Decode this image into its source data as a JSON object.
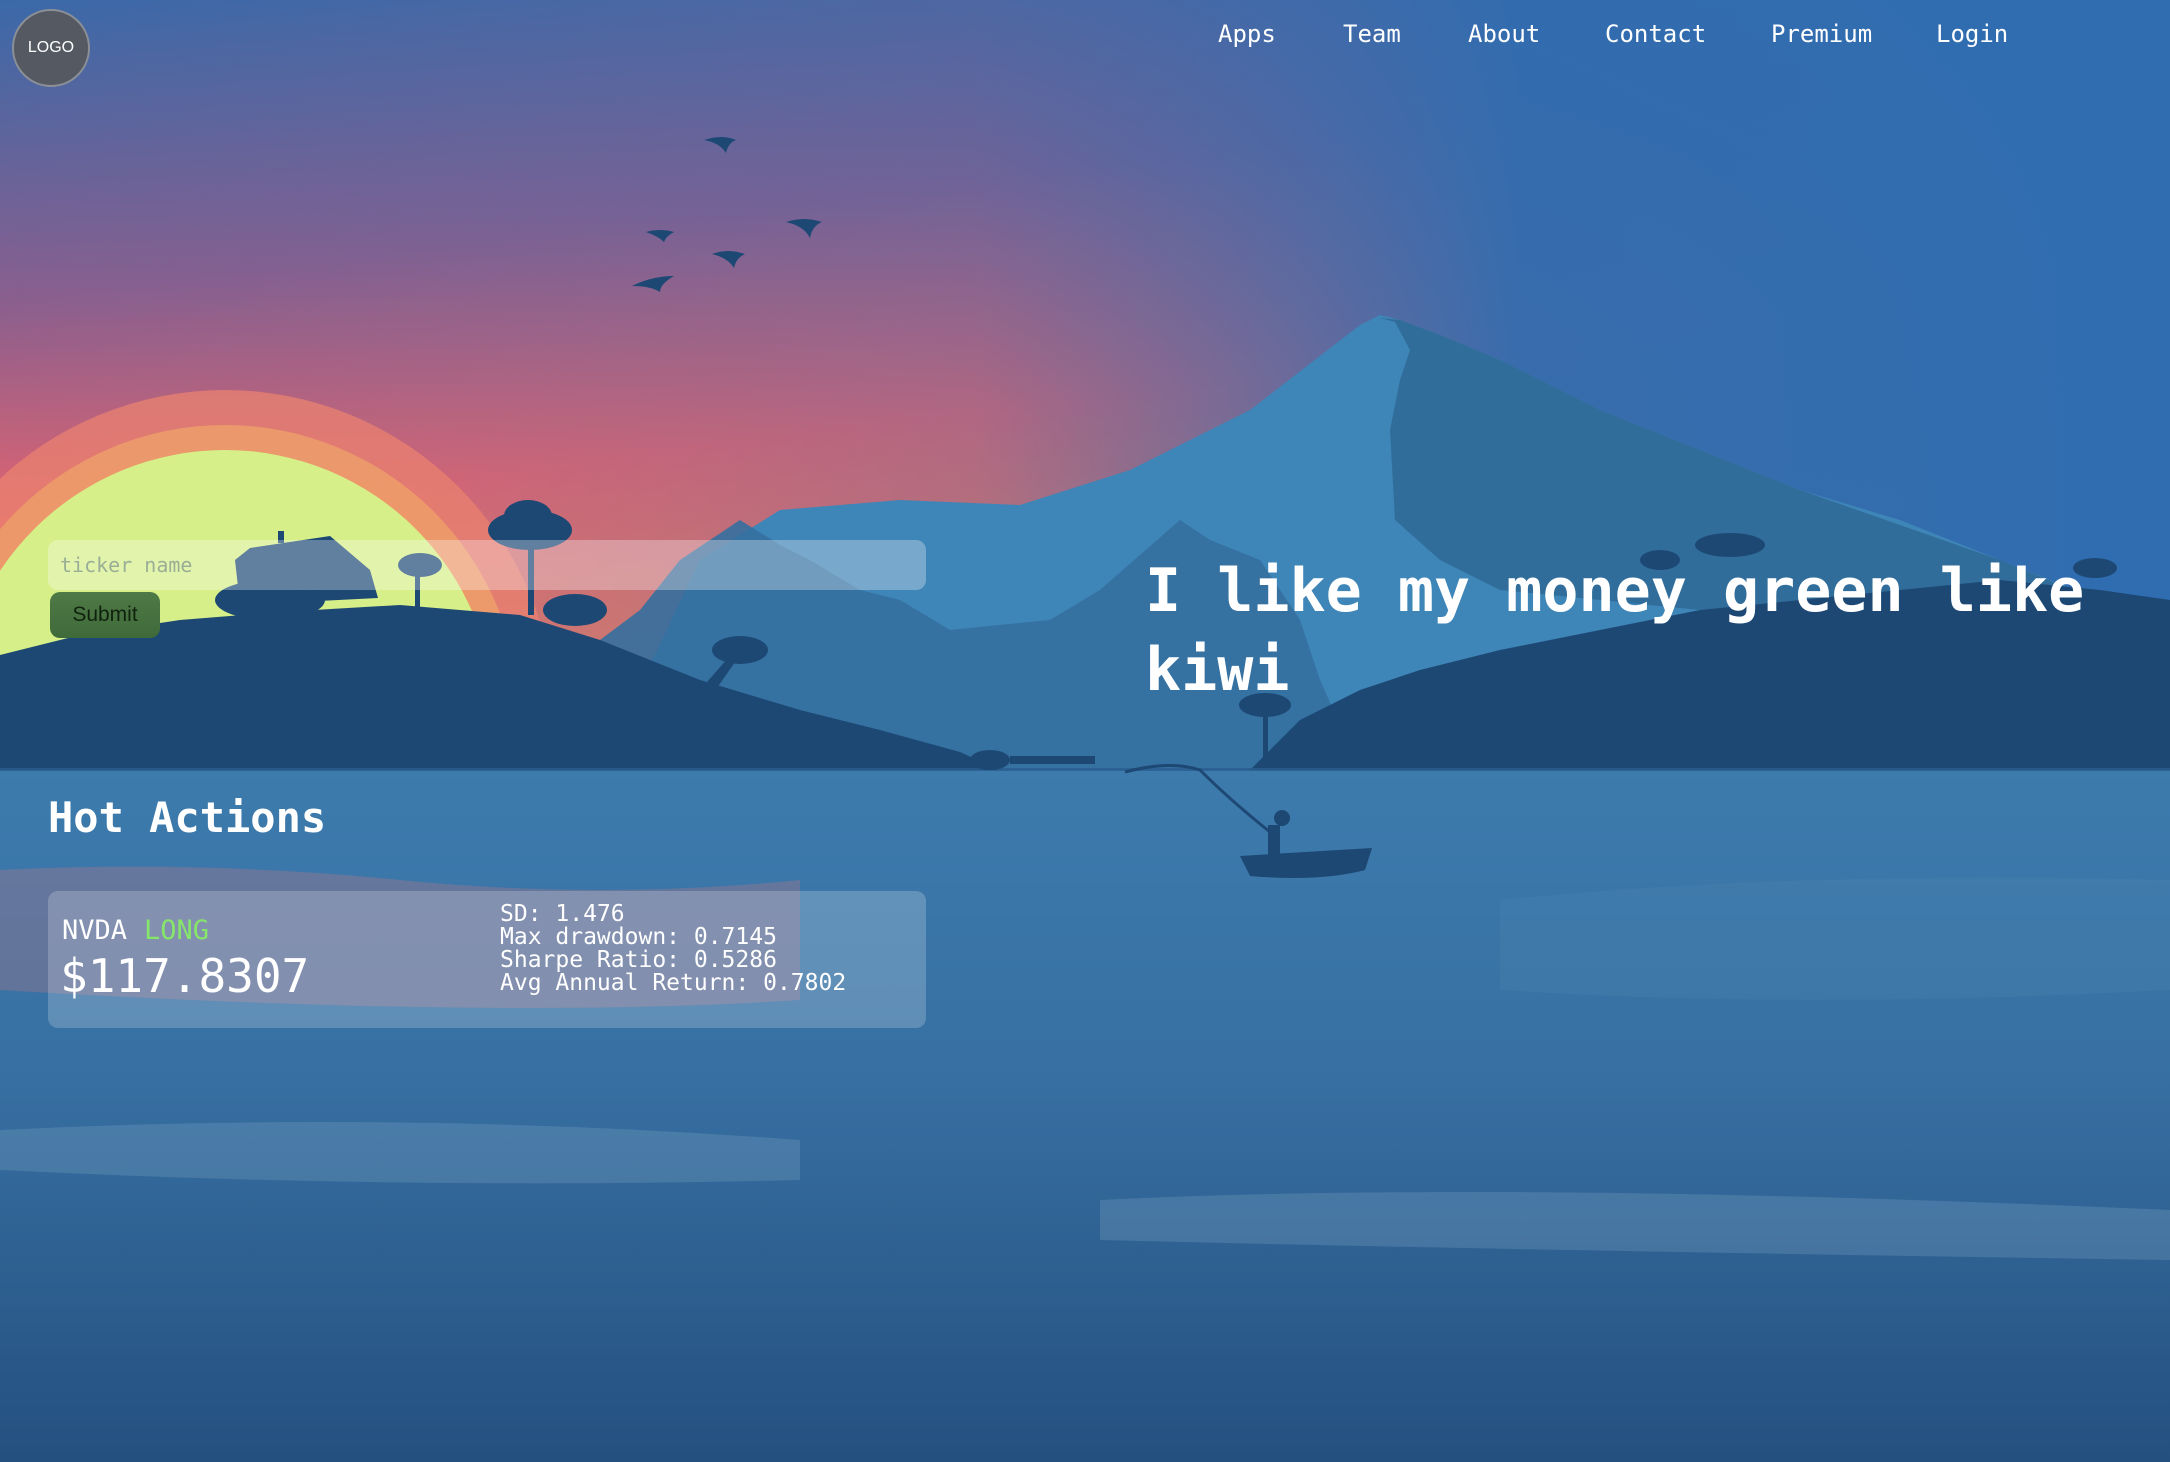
{
  "logo": {
    "label": "LOGO"
  },
  "nav": {
    "items": [
      "Apps",
      "Team",
      "About",
      "Contact",
      "Premium",
      "Login"
    ]
  },
  "search": {
    "placeholder": "ticker name",
    "value": "",
    "submit_label": "Submit"
  },
  "hero": {
    "headline": "I like my money green like kiwi"
  },
  "hot_actions": {
    "title": "Hot Actions",
    "cards": [
      {
        "symbol": "NVDA",
        "direction": "LONG",
        "price": "$117.8307",
        "stats": [
          "SD: 1.476",
          "Max drawdown: 0.7145",
          "Sharpe Ratio: 0.5286",
          "Avg Annual Return: 0.7802"
        ]
      }
    ]
  },
  "colors": {
    "sky_top": "#2f6db0",
    "sky_horizon": "#ef6a6a",
    "sun": "#d8f08a",
    "mountain": "#3c82b4",
    "land": "#1e4a76",
    "water": "#3b79ab",
    "long_accent": "#86e66a"
  }
}
